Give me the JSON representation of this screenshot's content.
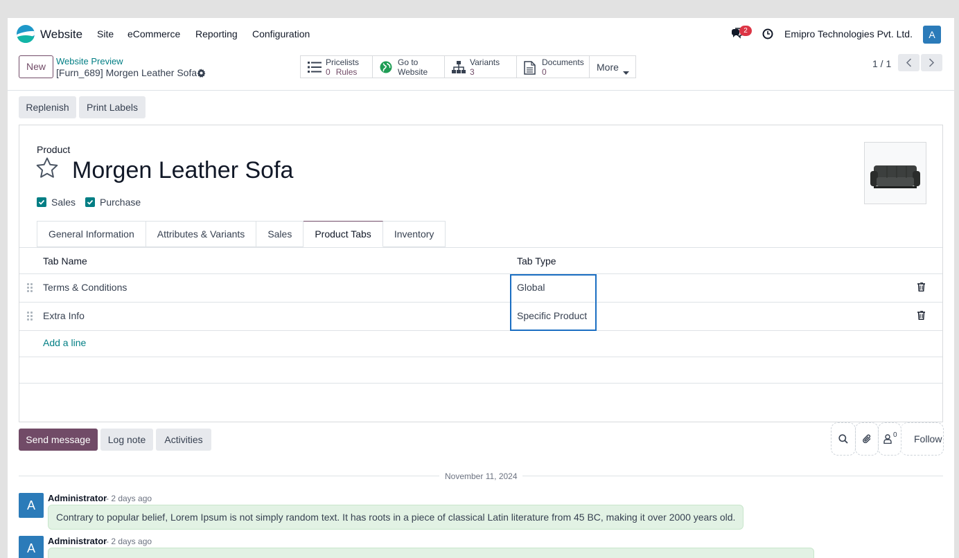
{
  "navbar": {
    "app_name": "Website",
    "menu": [
      "Site",
      "eCommerce",
      "Reporting",
      "Configuration"
    ],
    "chat_count": "2",
    "company": "Emipro Technologies Pvt. Ltd.",
    "avatar_letter": "A"
  },
  "control_panel": {
    "new_label": "New",
    "breadcrumb": "Website Preview",
    "record_name": "[Furn_689] Morgen Leather Sofa",
    "smart_buttons": {
      "pricelists": {
        "label": "Pricelists",
        "count": "0",
        "suffix": "Rules"
      },
      "website": {
        "label": "Go to",
        "label2": "Website"
      },
      "variants": {
        "label": "Variants",
        "count": "3"
      },
      "documents": {
        "label": "Documents",
        "count": "0"
      },
      "more": "More"
    },
    "pager": "1 / 1"
  },
  "actions": {
    "replenish": "Replenish",
    "print_labels": "Print Labels"
  },
  "form": {
    "product_label": "Product",
    "title": "Morgen Leather Sofa",
    "checkboxes": {
      "sales": "Sales",
      "purchase": "Purchase"
    },
    "tabs": [
      "General Information",
      "Attributes & Variants",
      "Sales",
      "Product Tabs",
      "Inventory"
    ],
    "active_tab": "Product Tabs",
    "table": {
      "headers": {
        "name": "Tab Name",
        "type": "Tab Type"
      },
      "rows": [
        {
          "name": "Terms & Conditions",
          "type": "Global"
        },
        {
          "name": "Extra Info",
          "type": "Specific Product"
        }
      ],
      "add_line": "Add a line"
    }
  },
  "chatter": {
    "send_message": "Send message",
    "log_note": "Log note",
    "activities": "Activities",
    "followers_count": "0",
    "follow": "Follow",
    "date_separator": "November 11, 2024",
    "messages": [
      {
        "avatar": "A",
        "author": "Administrator",
        "time": "- 2 days ago",
        "body": "Contrary to popular belief, Lorem Ipsum is not simply random text. It has roots in a piece of classical Latin literature from 45 BC, making it over 2000 years old."
      },
      {
        "avatar": "A",
        "author": "Administrator",
        "time": "- 2 days ago",
        "body": ""
      }
    ]
  },
  "colors": {
    "brand": "#714b67",
    "link": "#017e84",
    "highlight": "#1a6ec2",
    "badge": "#dc3545"
  }
}
